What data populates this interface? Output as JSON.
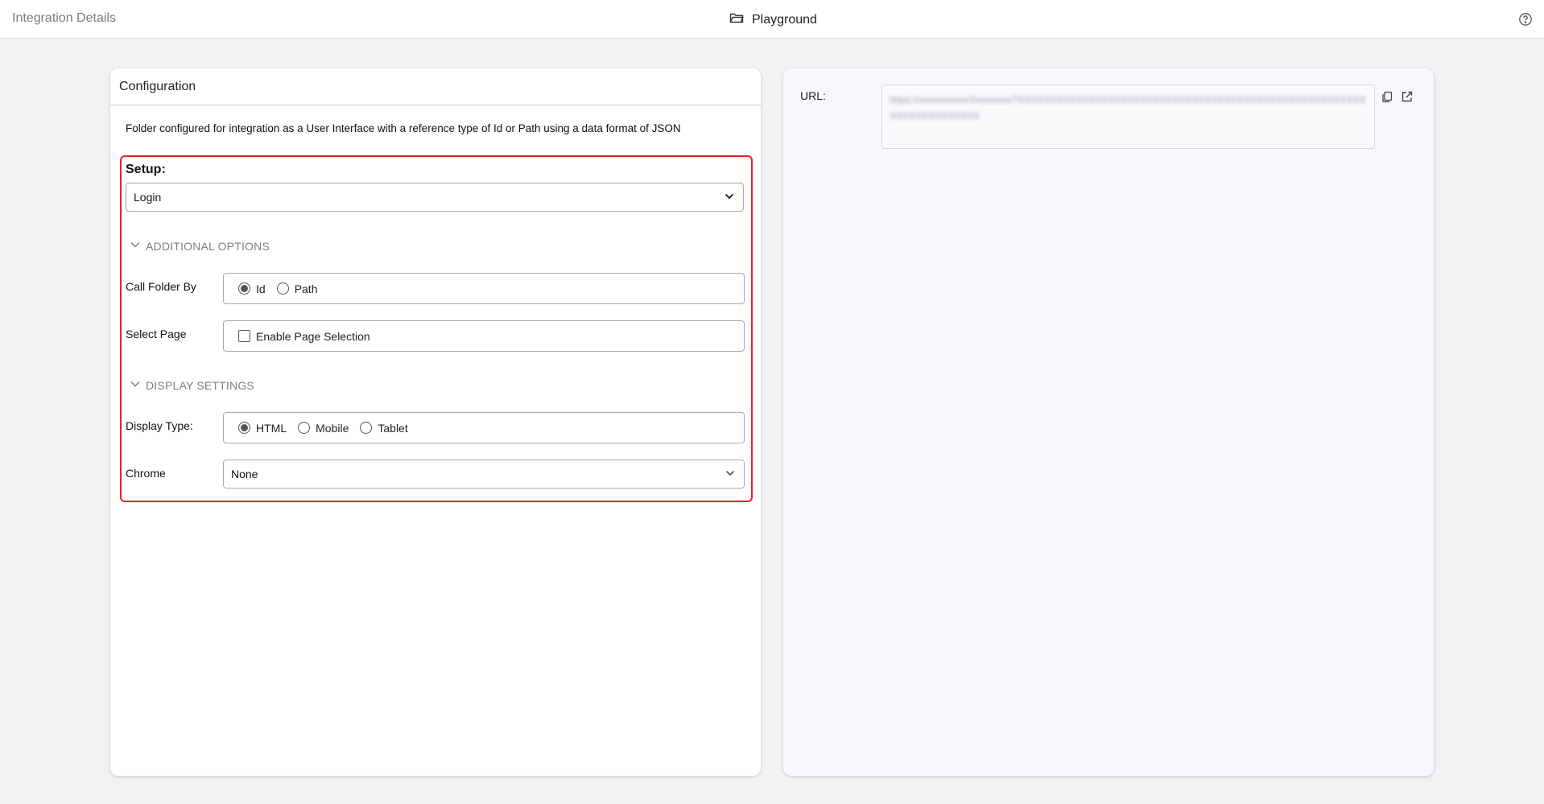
{
  "header": {
    "breadcrumb": "Integration Details",
    "title": "Playground"
  },
  "config": {
    "title": "Configuration",
    "description": "Folder configured for integration as a User Interface with a reference type of Id or Path using a data format of JSON",
    "setup": {
      "label": "Setup:",
      "selected": "Login"
    },
    "additional_options": {
      "heading": "ADDITIONAL OPTIONS",
      "call_folder_by": {
        "label": "Call Folder By",
        "options": [
          "Id",
          "Path"
        ],
        "selected": "Id"
      },
      "select_page": {
        "label": "Select Page",
        "checkbox_label": "Enable Page Selection",
        "checked": false
      }
    },
    "display_settings": {
      "heading": "DISPLAY SETTINGS",
      "display_type": {
        "label": "Display Type:",
        "options": [
          "HTML",
          "Mobile",
          "Tablet"
        ],
        "selected": "HTML"
      },
      "chrome": {
        "label": "Chrome",
        "selected": "None"
      }
    }
  },
  "url_panel": {
    "label": "URL:",
    "value": "https://xxxxxxxxxx/Xxxxxxxx/?XXXXXXXXXXXXXXXXXXXXXXXXXXXXXXXXXXXXXXXXXXXXXXXXXXXXXXXXXXXXXXXXXXXX"
  },
  "colors": {
    "highlight_border": "#e8202a",
    "page_background": "#f2f2f4",
    "url_panel_background": "#f7f7fd"
  }
}
